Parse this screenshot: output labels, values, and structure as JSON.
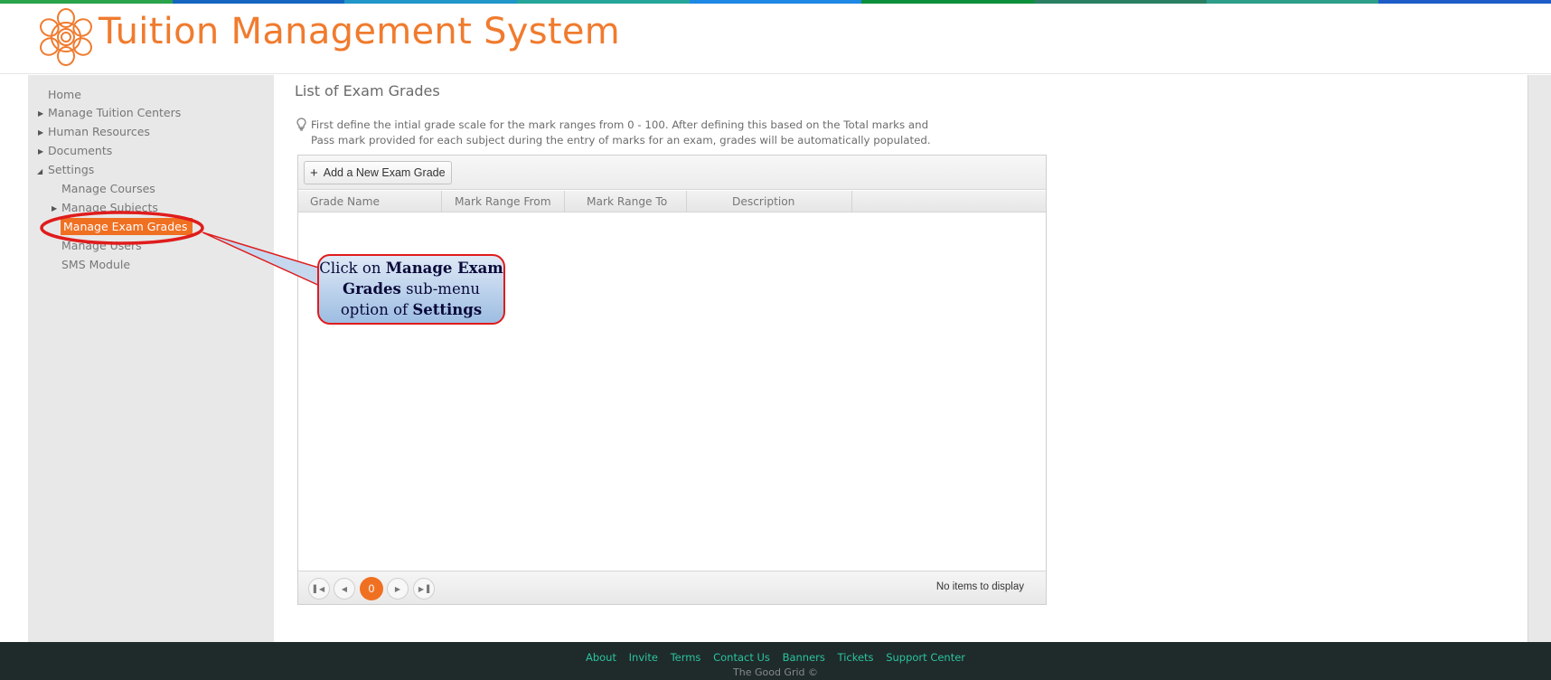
{
  "brand": {
    "strip_colors": [
      "#2aa34a",
      "#1565c0",
      "#2196c9",
      "#26a69a",
      "#1e88e5",
      "#0b8f3a",
      "#2a7f62",
      "#2e9e8a",
      "#1e5cc8"
    ],
    "app_title": "Tuition Management System",
    "title_color": "#f07b2e"
  },
  "sidebar": {
    "items": [
      {
        "label": "Home",
        "expand": ""
      },
      {
        "label": "Manage Tuition Centers",
        "expand": "collapsed"
      },
      {
        "label": "Human Resources",
        "expand": "collapsed"
      },
      {
        "label": "Documents",
        "expand": "collapsed"
      },
      {
        "label": "Settings",
        "expand": "expanded"
      }
    ],
    "sub_items": [
      {
        "label": "Manage Courses"
      },
      {
        "label": "Manage Subjects"
      },
      {
        "label": "Manage Exam Grades",
        "active": true
      },
      {
        "label": "Manage Users"
      },
      {
        "label": "SMS Module"
      }
    ]
  },
  "main": {
    "title": "List of Exam Grades",
    "hint_line1": "First define the intial grade scale for the mark ranges from 0 - 100. After defining this based on the Total marks and",
    "hint_line2": "Pass mark provided for each subject during the entry of marks for an exam, grades will be automatically populated.",
    "hint_icon": "lightbulb-icon",
    "grid": {
      "add_button": "Add a New Exam Grade",
      "columns": [
        "Grade Name",
        "Mark Range From",
        "Mark Range To",
        "Description"
      ],
      "rows": [],
      "pager": {
        "current_page": "0",
        "info": "No items to display",
        "buttons": [
          "first-page-icon",
          "prev-page-icon",
          "next-page-icon",
          "last-page-icon"
        ]
      }
    }
  },
  "callout": {
    "part1": "Click on ",
    "bold1": "Manage Exam Grades",
    "part2": " sub-menu option of ",
    "bold2": "Settings"
  },
  "footer": {
    "links": [
      "About",
      "Invite",
      "Terms",
      "Contact Us",
      "Banners",
      "Tickets",
      "Support Center"
    ],
    "copyright": "The Good Grid ©"
  },
  "colors": {
    "accent": "#f07022",
    "footer_bg": "#1f2a2a",
    "footer_link": "#2bc3a0",
    "annotation_red": "#e01c1c"
  }
}
